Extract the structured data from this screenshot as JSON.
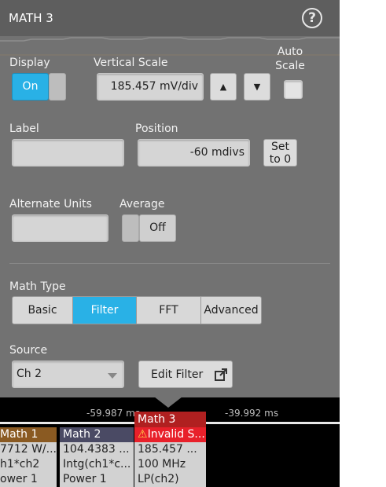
{
  "panel": {
    "title": "MATH 3",
    "help_glyph": "?",
    "display": {
      "label": "Display",
      "value": "On"
    },
    "vertical_scale": {
      "label": "Vertical Scale",
      "value": "185.457 mV/div",
      "up_glyph": "▲",
      "down_glyph": "▼"
    },
    "auto_scale": {
      "label": "Auto Scale",
      "checked": false
    },
    "label_field": {
      "label": "Label",
      "value": ""
    },
    "position": {
      "label": "Position",
      "value": "-60 mdivs",
      "set_to_zero": "Set to 0"
    },
    "alternate_units": {
      "label": "Alternate Units",
      "value": ""
    },
    "average": {
      "label": "Average",
      "value": "Off"
    },
    "math_type": {
      "label": "Math Type",
      "options": [
        "Basic",
        "Filter",
        "FFT",
        "Advanced"
      ],
      "selected": "Filter"
    },
    "source": {
      "label": "Source",
      "value": "Ch 2",
      "edit_filter": "Edit Filter"
    }
  },
  "timebase": {
    "left_tick": "-59.987 ms",
    "right_tick": "-39.992 ms"
  },
  "badges": [
    {
      "title": "Math 1",
      "lines": [
        "7712 W/...",
        "h1*ch2",
        "ower 1"
      ],
      "color": "#8a5a22"
    },
    {
      "title": "Math 2",
      "lines": [
        "104.4383 ...",
        "Intg(ch1*c...",
        "Power 1"
      ],
      "color": "#4a4a64"
    },
    {
      "title": "Math 3",
      "warning": "Invalid S...",
      "lines": [
        "185.457 ...",
        "100 MHz",
        "LP(ch2)"
      ],
      "color": "#b02020"
    }
  ],
  "colors": {
    "accent": "#29b1e6",
    "panel": "#727272",
    "title_bar": "#5e5e5e",
    "warning": "#e8202a"
  }
}
